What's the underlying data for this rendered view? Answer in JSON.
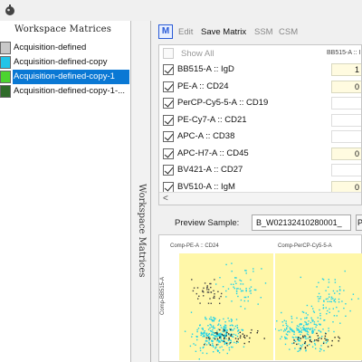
{
  "left_panel": {
    "title": "Workspace Matrices",
    "matrices": [
      {
        "label": "Acquisition-defined",
        "swatch": "#c8c8c8",
        "selected": false
      },
      {
        "label": "Acquisition-defined-copy",
        "swatch": "#22c4e8",
        "selected": false
      },
      {
        "label": "Acquisition-defined-copy-1",
        "swatch": "#4cd430",
        "selected": true
      },
      {
        "label": "Acquisition-defined-copy-1-...",
        "swatch": "#2f6b2a",
        "selected": false
      }
    ]
  },
  "side_tab": {
    "label": "Workspace Matrices"
  },
  "toolbar": {
    "m_icon": "M",
    "edit": "Edit",
    "save_matrix": "Save Matrix",
    "ssm": "SSM",
    "csm": "CSM"
  },
  "grid": {
    "show_all": "Show All",
    "column_header": "BB515-A :: I",
    "rows": [
      {
        "name": "BB515-A :: IgD",
        "value": "1",
        "checked": true
      },
      {
        "name": "PE-A :: CD24",
        "value": "0",
        "checked": true
      },
      {
        "name": "PerCP-Cy5-5-A :: CD19",
        "value": "",
        "checked": true
      },
      {
        "name": "PE-Cy7-A :: CD21",
        "value": "",
        "checked": true
      },
      {
        "name": "APC-A :: CD38",
        "value": "",
        "checked": true
      },
      {
        "name": "APC-H7-A :: CD45",
        "value": "0",
        "checked": true
      },
      {
        "name": "BV421-A :: CD27",
        "value": "",
        "checked": true
      },
      {
        "name": "BV510-A :: IgM",
        "value": "0",
        "checked": true
      }
    ]
  },
  "preview": {
    "label": "Preview Sample:",
    "sample": "B_W02132410280001_",
    "more": "Pr"
  },
  "plots": {
    "titles": [
      "Comp-PE-A :: CD24",
      "Comp-PerCP-Cy5-5-A"
    ],
    "y_axis": "Comp-BB515-A"
  },
  "colors": {
    "accent_blue": "#0a78d4",
    "plot_bg": "#fff7a8",
    "dots": "#1fd2e8"
  }
}
